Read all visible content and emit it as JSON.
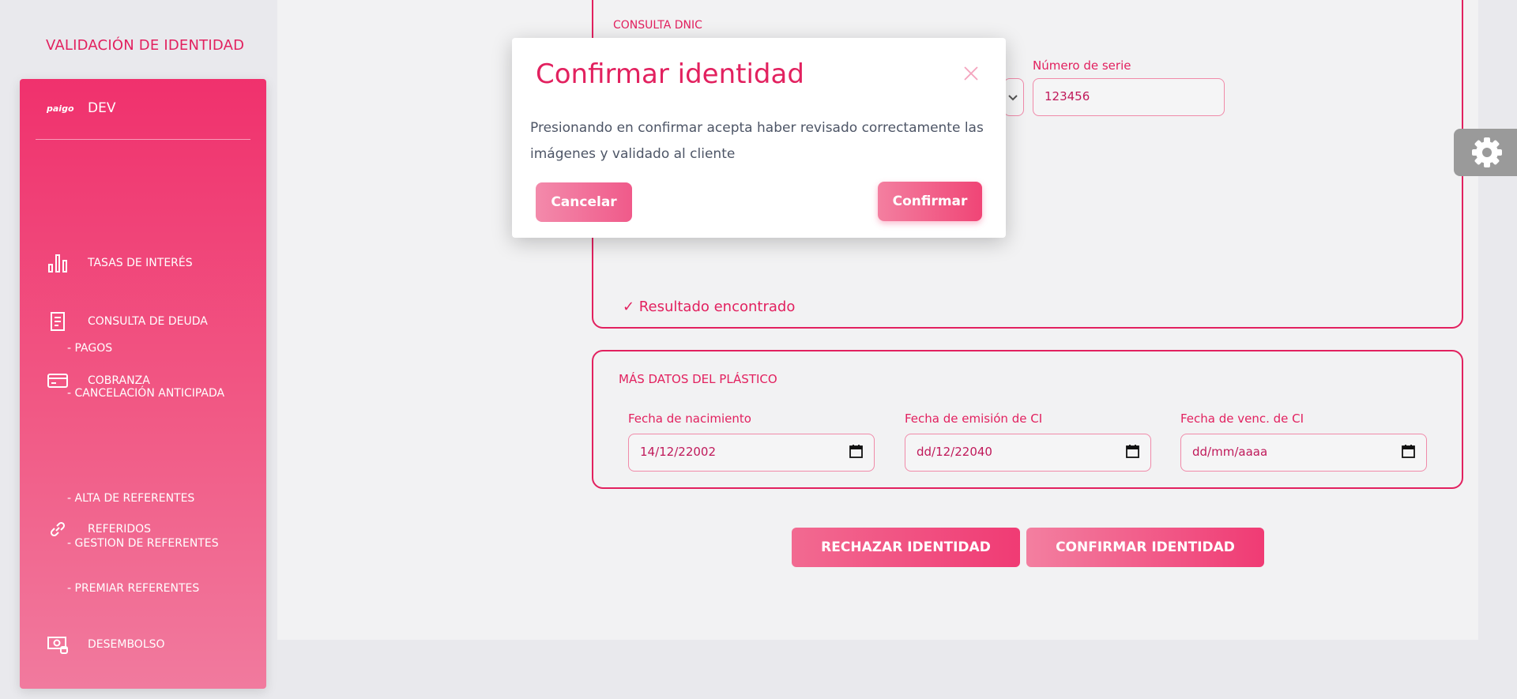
{
  "header": {
    "title": "VALIDACIÓN DE IDENTIDAD"
  },
  "sidebar": {
    "logo": "paigo",
    "env": "DEV",
    "items": [
      {
        "label": "TASAS DE INTERÉS",
        "icon": "bar-chart-icon"
      },
      {
        "label": "CONSULTA DE DEUDA",
        "icon": "receipt-icon"
      },
      {
        "label": "COBRANZA",
        "icon": "credit-card-icon"
      },
      {
        "label": "- PAGOS"
      },
      {
        "label": "- CANCELACIÓN ANTICIPADA"
      },
      {
        "label": "REFERIDOS",
        "icon": "link-icon"
      },
      {
        "label": "- ALTA DE REFERENTES"
      },
      {
        "label": "- GESTION DE REFERENTES"
      },
      {
        "label": "- PREMIAR REFERENTES"
      },
      {
        "label": "DESEMBOLSO",
        "icon": "money-icon"
      }
    ]
  },
  "consulta": {
    "title": "CONSULTA DNIC",
    "serie_label": "Número de serie",
    "serie_value": "123456",
    "result": "✓ Resultado encontrado"
  },
  "plastico": {
    "title": "MÁS DATOS DEL PLÁSTICO",
    "fields": [
      {
        "label": "Fecha de nacimiento",
        "value": "14/12/22002"
      },
      {
        "label": "Fecha de emisión de CI",
        "value": "dd/12/22040"
      },
      {
        "label": "Fecha de venc. de CI",
        "value": "dd/mm/aaaa"
      }
    ]
  },
  "actions": {
    "reject": "RECHAZAR IDENTIDAD",
    "confirm": "CONFIRMAR IDENTIDAD"
  },
  "modal": {
    "title": "Confirmar identidad",
    "body": "Presionando en confirmar acepta haber revisado correctamente las imágenes y validado al cliente",
    "cancel": "Cancelar",
    "confirm": "Confirmar"
  },
  "colors": {
    "accent": "#e2215f",
    "sidebar_top": "#f0316d",
    "sidebar_bottom": "#f17a9e",
    "text_body": "#4d5566"
  }
}
